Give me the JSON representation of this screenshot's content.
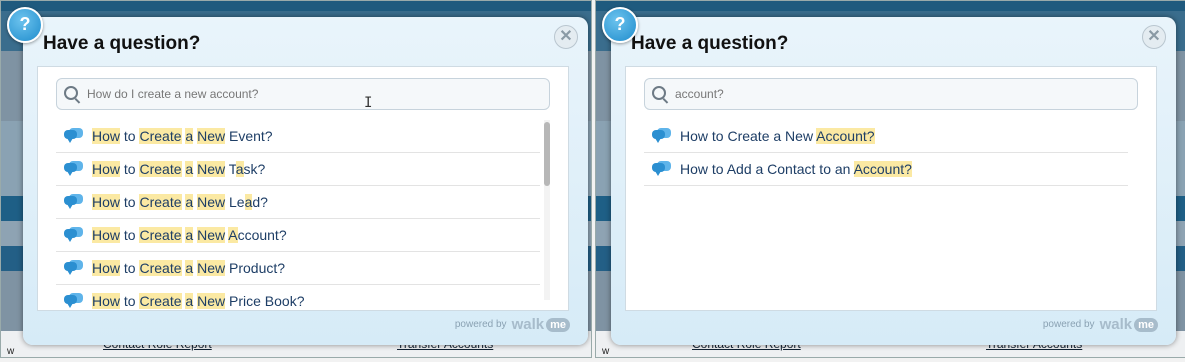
{
  "left_panel": {
    "title": "Have a question?",
    "badge": "?",
    "close": "✕",
    "search": {
      "value": "How do I create a new account?",
      "placeholder": ""
    },
    "cursor": "I",
    "results": [
      [
        [
          "How",
          "h"
        ],
        [
          " to ",
          ""
        ],
        [
          "Create",
          "h"
        ],
        [
          " ",
          ""
        ],
        [
          "a",
          "h"
        ],
        [
          " ",
          ""
        ],
        [
          "New",
          "h"
        ],
        [
          " Event?",
          ""
        ]
      ],
      [
        [
          "How",
          "h"
        ],
        [
          " to ",
          ""
        ],
        [
          "Create",
          "h"
        ],
        [
          " ",
          ""
        ],
        [
          "a",
          "h"
        ],
        [
          " ",
          ""
        ],
        [
          "New",
          "h"
        ],
        [
          " T",
          ""
        ],
        [
          "a",
          "h"
        ],
        [
          "sk?",
          ""
        ]
      ],
      [
        [
          "How",
          "h"
        ],
        [
          " to ",
          ""
        ],
        [
          "Create",
          "h"
        ],
        [
          " ",
          ""
        ],
        [
          "a",
          "h"
        ],
        [
          " ",
          ""
        ],
        [
          "New",
          "h"
        ],
        [
          " Le",
          ""
        ],
        [
          "a",
          "h"
        ],
        [
          "d?",
          ""
        ]
      ],
      [
        [
          "How",
          "h"
        ],
        [
          " to ",
          ""
        ],
        [
          "Create",
          "h"
        ],
        [
          " ",
          ""
        ],
        [
          "a",
          "h"
        ],
        [
          " ",
          ""
        ],
        [
          "New",
          "h"
        ],
        [
          " ",
          ""
        ],
        [
          "A",
          "h"
        ],
        [
          "ccount?",
          ""
        ]
      ],
      [
        [
          "How",
          "h"
        ],
        [
          " to ",
          ""
        ],
        [
          "Create",
          "h"
        ],
        [
          " ",
          ""
        ],
        [
          "a",
          "h"
        ],
        [
          " ",
          ""
        ],
        [
          "New",
          "h"
        ],
        [
          " Product?",
          ""
        ]
      ],
      [
        [
          "How",
          "h"
        ],
        [
          " to ",
          ""
        ],
        [
          "Create",
          "h"
        ],
        [
          " ",
          ""
        ],
        [
          "a",
          "h"
        ],
        [
          " ",
          ""
        ],
        [
          "New",
          "h"
        ],
        [
          " Price Book?",
          ""
        ]
      ]
    ],
    "powered_by": "powered by",
    "brand_walk": "walk",
    "brand_me": "me",
    "bg_links": [
      "Contact Role Report",
      "Transfer Accounts"
    ],
    "bg_letter": "w"
  },
  "right_panel": {
    "title": "Have a question?",
    "badge": "?",
    "close": "✕",
    "search": {
      "value": "account?",
      "placeholder": ""
    },
    "results": [
      [
        [
          "How to Create a New ",
          ""
        ],
        [
          "Account?",
          "h"
        ]
      ],
      [
        [
          "How to Add a Contact to an ",
          ""
        ],
        [
          "Account?",
          "h"
        ]
      ]
    ],
    "powered_by": "powered by",
    "brand_walk": "walk",
    "brand_me": "me",
    "bg_links": [
      "Contact Role Report",
      "Transfer Accounts"
    ],
    "bg_letter": "w"
  },
  "colors": {
    "highlight": "#fbe9a3",
    "link_text": "#1e3e66",
    "badge": "#1f8ccc"
  }
}
